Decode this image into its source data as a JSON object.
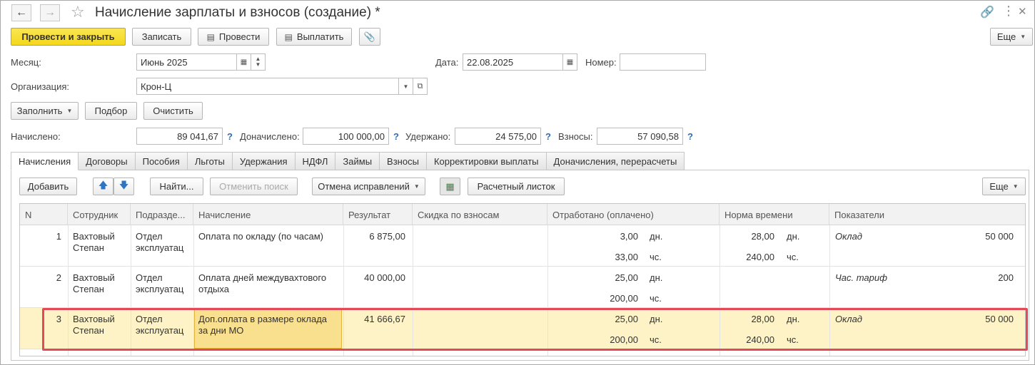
{
  "title": "Начисление зарплаты и взносов (создание) *",
  "toolbar": {
    "post_close": "Провести и закрыть",
    "save": "Записать",
    "post": "Провести",
    "pay": "Выплатить",
    "more": "Еще"
  },
  "form": {
    "month_label": "Месяц:",
    "month_value": "Июнь 2025",
    "date_label": "Дата:",
    "date_value": "22.08.2025",
    "number_label": "Номер:",
    "number_value": "",
    "org_label": "Организация:",
    "org_value": "Крон-Ц",
    "fill": "Заполнить",
    "select": "Подбор",
    "clear": "Очистить",
    "accrued_label": "Начислено:",
    "accrued_value": "89 041,67",
    "add_accrued_label": "Доначислено:",
    "add_accrued_value": "100 000,00",
    "withheld_label": "Удержано:",
    "withheld_value": "24 575,00",
    "contrib_label": "Взносы:",
    "contrib_value": "57 090,58",
    "help": "?"
  },
  "tabs": [
    "Начисления",
    "Договоры",
    "Пособия",
    "Льготы",
    "Удержания",
    "НДФЛ",
    "Займы",
    "Взносы",
    "Корректировки выплаты",
    "Доначисления, перерасчеты"
  ],
  "grid_toolbar": {
    "add": "Добавить",
    "find": "Найти...",
    "cancel_search": "Отменить поиск",
    "cancel_corrections": "Отмена исправлений",
    "payslip": "Расчетный листок",
    "more": "Еще"
  },
  "columns": [
    "N",
    "Сотрудник",
    "Подразде...",
    "Начисление",
    "Результат",
    "Скидка по взносам",
    "Отработано (оплачено)",
    "Норма времени",
    "Показатели"
  ],
  "rows": [
    {
      "n": "1",
      "employee_1": "Вахтовый",
      "employee_2": "Степан",
      "dept_1": "Отдел",
      "dept_2": "эксплуатац",
      "accrual_1": "Оплата по окладу (по часам)",
      "accrual_2": "",
      "result": "6 875,00",
      "worked_days": "3,00",
      "worked_days_unit": "дн.",
      "worked_hours": "33,00",
      "worked_hours_unit": "чс.",
      "norm_days": "28,00",
      "norm_days_unit": "дн.",
      "norm_hours": "240,00",
      "norm_hours_unit": "чс.",
      "indicator": "Оклад",
      "indicator_value": "50 000"
    },
    {
      "n": "2",
      "employee_1": "Вахтовый",
      "employee_2": "Степан",
      "dept_1": "Отдел",
      "dept_2": "эксплуатац",
      "accrual_1": "Оплата дней междувахтового",
      "accrual_2": "отдыха",
      "result": "40 000,00",
      "worked_days": "25,00",
      "worked_days_unit": "дн.",
      "worked_hours": "200,00",
      "worked_hours_unit": "чс.",
      "norm_days": "",
      "norm_days_unit": "",
      "norm_hours": "",
      "norm_hours_unit": "",
      "indicator": "Час. тариф",
      "indicator_value": "200"
    },
    {
      "n": "3",
      "employee_1": "Вахтовый",
      "employee_2": "Степан",
      "dept_1": "Отдел",
      "dept_2": "эксплуатац",
      "accrual_1": "Доп.оплата в размере оклада",
      "accrual_2": "за дни МО",
      "result": "41 666,67",
      "worked_days": "25,00",
      "worked_days_unit": "дн.",
      "worked_hours": "200,00",
      "worked_hours_unit": "чс.",
      "norm_days": "28,00",
      "norm_days_unit": "дн.",
      "norm_hours": "240,00",
      "norm_hours_unit": "чс.",
      "indicator": "Оклад",
      "indicator_value": "50 000"
    }
  ],
  "colors": {
    "primary_button": "#f3d81a",
    "selected_row": "#fdf3c7",
    "highlight_frame": "#e24a57",
    "help": "#2f6db5"
  }
}
